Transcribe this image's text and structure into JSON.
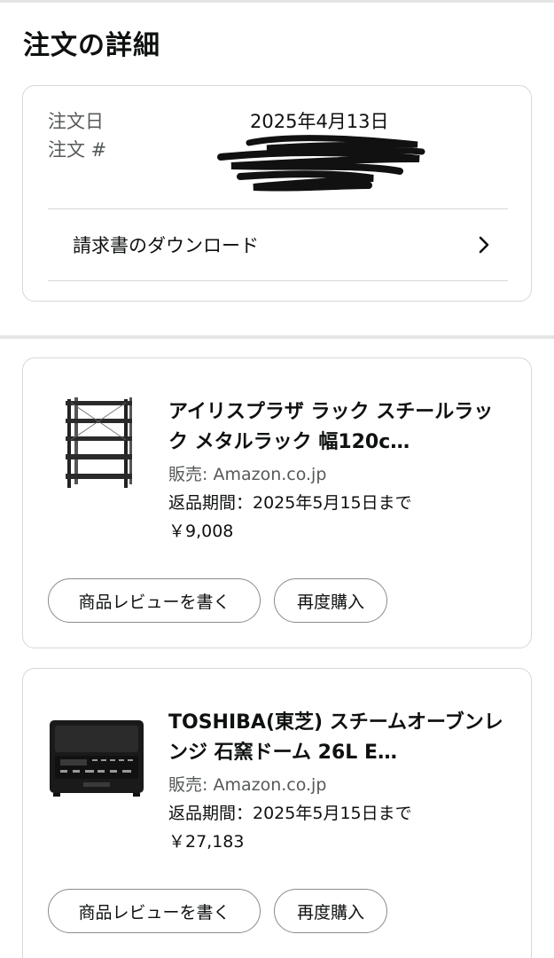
{
  "header": {
    "title": "注文の詳細"
  },
  "order": {
    "date_label": "注文日",
    "date_value": "2025年4月13日",
    "number_label": "注文 #",
    "invoice_label": "請求書のダウンロード"
  },
  "items": [
    {
      "title": "アイリスプラザ ラック スチールラック メタルラック 幅120c…",
      "seller": "販売: Amazon.co.jp",
      "return_period": "返品期間：2025年5月15日まで",
      "price": "￥9,008",
      "review_label": "商品レビューを書く",
      "rebuy_label": "再度購入",
      "thumb_icon": "steel-rack-icon"
    },
    {
      "title": "TOSHIBA(東芝) スチームオーブンレンジ 石窯ドーム 26L E…",
      "seller": "販売: Amazon.co.jp",
      "return_period": "返品期間：2025年5月15日まで",
      "price": "￥27,183",
      "review_label": "商品レビューを書く",
      "rebuy_label": "再度購入",
      "thumb_icon": "microwave-oven-icon"
    }
  ],
  "colors": {
    "text": "#0f1111",
    "muted": "#565959",
    "border": "#d5d9d9"
  }
}
